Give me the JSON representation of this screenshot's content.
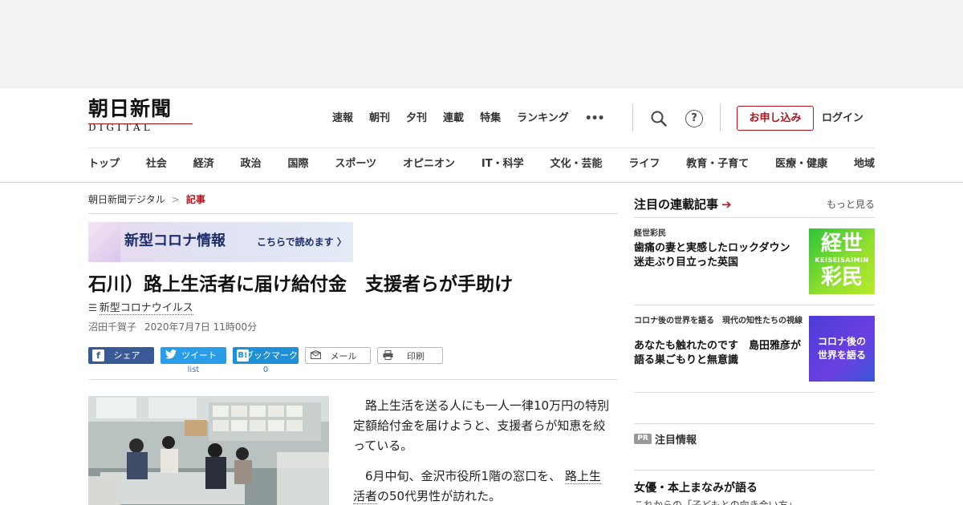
{
  "header": {
    "logo_jp": "朝日新聞",
    "logo_en": "DIGITAL",
    "top_nav": [
      "速報",
      "朝刊",
      "夕刊",
      "連載",
      "特集",
      "ランキング"
    ],
    "more_icon": "•••",
    "help_icon": "?",
    "subscribe_label": "お申し込み",
    "login_label": "ログイン",
    "categories": [
      "トップ",
      "社会",
      "経済",
      "政治",
      "国際",
      "スポーツ",
      "オピニオン",
      "IT・科学",
      "文化・芸能",
      "ライフ",
      "教育・子育て",
      "医療・健康",
      "地域"
    ]
  },
  "breadcrumb": {
    "home": "朝日新聞デジタル",
    "separator": ">",
    "current": "記事"
  },
  "corona_banner": {
    "title": "新型コロナ情報",
    "cta": "こちらで読めます 〉"
  },
  "article": {
    "headline": "石川）路上生活者に届け給付金　支援者らが手助け",
    "tag": "新型コロナウイルス",
    "list_icon": "☰",
    "author": "沼田千賀子",
    "date": "2020年7月7日 11時00分",
    "share": {
      "facebook_icon": "f",
      "facebook": "シェア",
      "twitter": "ツイート",
      "twitter_count": "list",
      "hatena_icon": "B!",
      "hatena": "ブックマーク",
      "hatena_count": "0",
      "mail": "メール",
      "print": "印刷"
    },
    "paragraph1": "路上生活を送る人にも一人一律10万円の特別定額給付金を届けようと、支援者らが知恵を絞っている。",
    "paragraph2_lead": "6月中旬、金沢市役所1階の窓口を、",
    "paragraph2_link": "路上生活者",
    "paragraph2_tail": "の50代男性が訪れた。"
  },
  "sidebar": {
    "title": "注目の連載記事",
    "arrow": "➔",
    "more": "もっと見る",
    "items": [
      {
        "series": "経世彩民",
        "title": "歯痛の妻と実感したロックダウン　迷走ぶり目立った英国",
        "thumb_line1": "経世",
        "thumb_line2": "KEISEISAIMIN",
        "thumb_line3": "彩民"
      },
      {
        "series": "コロナ後の世界を語る　現代の知性たちの視線",
        "title": "あなたも触れたのです　島田雅彦が語る巣ごもりと無意識",
        "thumb_line1": "コロナ後の",
        "thumb_line2": "世界を語る"
      }
    ],
    "pr_badge": "PR",
    "pr_title": "注目情報",
    "pr_item": "女優・本上まなみが語る",
    "pr_sub": "これからの「子どもとの向き合い方」"
  },
  "colors": {
    "brand_red": "#b0141d",
    "facebook": "#3a5a97",
    "twitter": "#2a9de8",
    "hatena": "#1f8fd6"
  }
}
